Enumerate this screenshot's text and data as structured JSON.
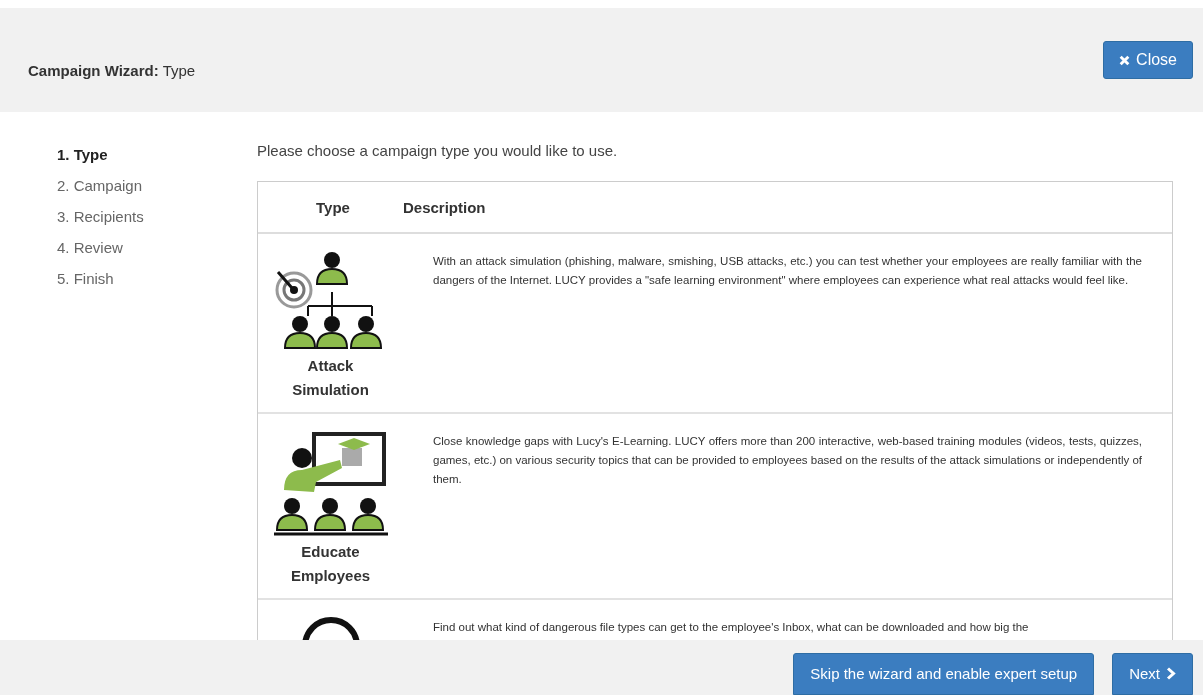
{
  "header": {
    "title_bold": "Campaign Wizard:",
    "title_step": "Type",
    "close_button": "Close"
  },
  "steps": [
    {
      "label": "1. Type",
      "selected": true
    },
    {
      "label": "2. Campaign",
      "selected": false
    },
    {
      "label": "3. Recipients",
      "selected": false
    },
    {
      "label": "4. Review",
      "selected": false
    },
    {
      "label": "5. Finish",
      "selected": false
    }
  ],
  "intro": "Please choose a campaign type you would like to use.",
  "table": {
    "columns": [
      "Type",
      "Description"
    ],
    "rows": [
      {
        "kind": "attack",
        "type": "Attack Simulation",
        "description": "With an attack simulation (phishing, malware, smishing, USB attacks, etc.) you can test whether your employees are really familiar with the dangers of the Internet. LUCY provides a \"safe learning environment\" where employees can experience what real attacks would feel like."
      },
      {
        "kind": "education",
        "type": "Educate Employees",
        "description": "Close knowledge gaps with Lucy's E-Learning. LUCY offers more than 200 interactive, web-based training modules (videos, tests, quizzes, games, etc.) on various security topics that can be provided to employees based on the results of the attack simulations or independently of them."
      },
      {
        "kind": "file",
        "description": "Find out what kind of dangerous file types can get to the employee's Inbox, what can be downloaded and how big the"
      }
    ]
  },
  "footer": {
    "skip_button": "Skip the wizard and enable expert setup",
    "next_button": "Next"
  }
}
